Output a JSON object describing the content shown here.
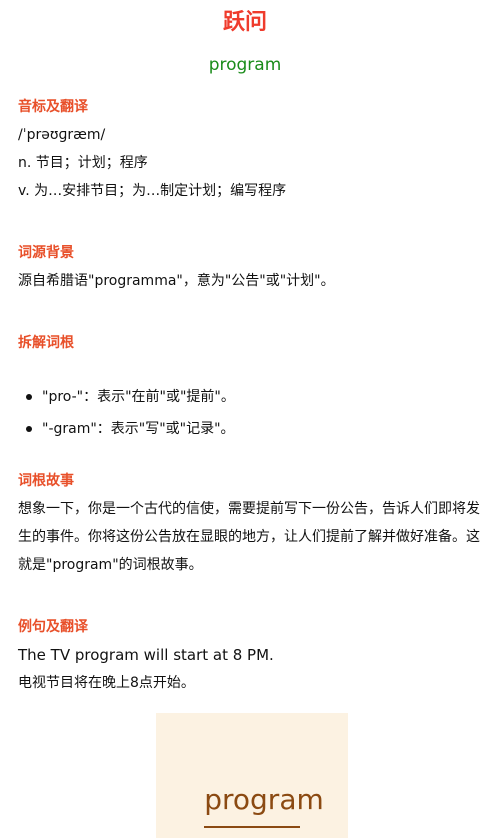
{
  "header": {
    "title": "跃问",
    "word": "program"
  },
  "sections": {
    "phonetic": {
      "heading": "音标及翻译",
      "ipa": "/ˈprəʊɡræm/",
      "noun": "n. 节目；计划；程序",
      "verb": "v. 为…安排节目；为…制定计划；编写程序"
    },
    "etymology": {
      "heading": "词源背景",
      "text": "源自希腊语\"programma\"，意为\"公告\"或\"计划\"。"
    },
    "roots": {
      "heading": "拆解词根",
      "items": [
        "\"pro-\"：表示\"在前\"或\"提前\"。",
        "\"-gram\"：表示\"写\"或\"记录\"。"
      ]
    },
    "story": {
      "heading": "词根故事",
      "text": "想象一下，你是一个古代的信使，需要提前写下一份公告，告诉人们即将发生的事件。你将这份公告放在显眼的地方，让人们提前了解并做好准备。这就是\"program\"的词根故事。"
    },
    "example": {
      "heading": "例句及翻译",
      "en": "The TV program will start at 8 PM.",
      "zh": "电视节目将在晚上8点开始。"
    }
  },
  "card": {
    "word": "program"
  },
  "colors": {
    "title": "#ef3b2c",
    "word": "#1a8c1a",
    "heading": "#e8502a",
    "card_bg": "#fcf2e2",
    "card_text": "#8b4a12"
  }
}
